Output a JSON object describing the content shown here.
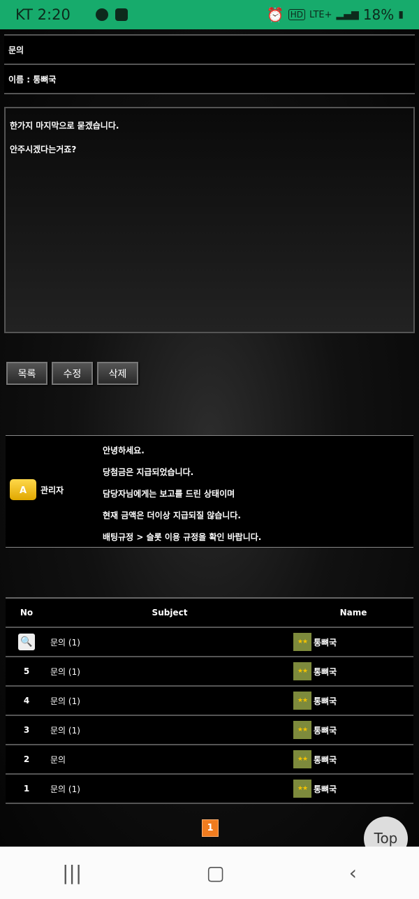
{
  "status_bar": {
    "carrier_time": "KT 2:20",
    "network": "LTE+",
    "hd": "HD",
    "battery": "18%"
  },
  "post": {
    "title": "문의",
    "author_line": "이름 : 통뼈국",
    "body": [
      "한가지 마지막으로 묻겠습니다.",
      "안주시겠다는거죠?"
    ]
  },
  "buttons": {
    "list": "목록",
    "edit": "수정",
    "delete": "삭제"
  },
  "comment": {
    "level_badge": "A",
    "author": "관리자",
    "lines": [
      "안녕하세요.",
      "당첨금은 지급되었습니다.",
      "담당자님에게는 보고를 드린 상태이며",
      "현재 금액은 더이상 지급되질 않습니다.",
      "배팅규정 > 슬롯 이용 규정을 확인 바랍니다."
    ]
  },
  "table": {
    "headers": {
      "no": "No",
      "subject": "Subject",
      "name": "Name"
    },
    "rows": [
      {
        "no": "",
        "subject": "문의 (1)",
        "name": "통뼈국",
        "current": true
      },
      {
        "no": "5",
        "subject": "문의 (1)",
        "name": "통뼈국"
      },
      {
        "no": "4",
        "subject": "문의 (1)",
        "name": "통뼈국"
      },
      {
        "no": "3",
        "subject": "문의 (1)",
        "name": "통뼈국"
      },
      {
        "no": "2",
        "subject": "문의",
        "name": "통뼈국"
      },
      {
        "no": "1",
        "subject": "문의 (1)",
        "name": "통뼈국"
      }
    ]
  },
  "pagination": {
    "current": "1",
    "accent": "#f07c1f"
  },
  "top_button": "Top",
  "colors": {
    "status_bar": "#17ab6c"
  }
}
